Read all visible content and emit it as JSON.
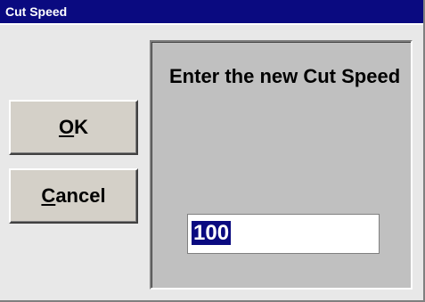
{
  "window": {
    "title": "Cut Speed"
  },
  "buttons": {
    "ok": {
      "mnemonic": "O",
      "rest": "K"
    },
    "cancel": {
      "mnemonic": "C",
      "rest": "ancel"
    }
  },
  "prompt": {
    "text": "Enter the new Cut Speed"
  },
  "input": {
    "value": "100",
    "selected": true
  },
  "colors": {
    "title_bar": "#0a0a80",
    "face": "#d4d0c8",
    "panel": "#c0c0c0",
    "client": "#e8e8e8",
    "selection": "#0a0a80"
  }
}
